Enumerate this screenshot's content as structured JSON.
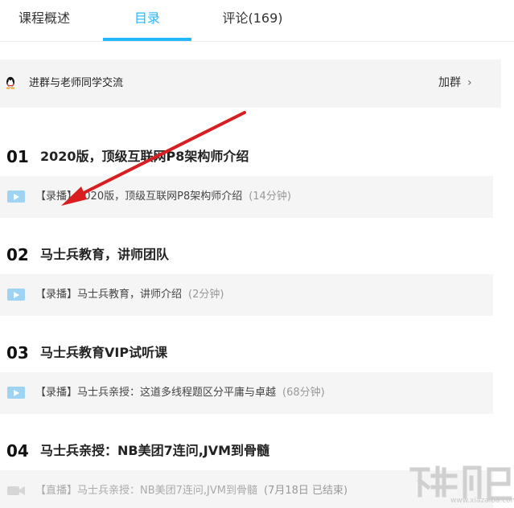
{
  "tabs": [
    {
      "label": "课程概述"
    },
    {
      "label": "目录"
    },
    {
      "label": "评论(169)"
    }
  ],
  "group": {
    "text": "进群与老师同学交流",
    "join_label": "加群"
  },
  "chapters": [
    {
      "num": "01",
      "title": "2020版，顶级互联网P8架构师介绍",
      "lesson": {
        "tag": "【录播】",
        "name": "2020版，顶级互联网P8架构师介绍",
        "duration": "(14分钟)"
      }
    },
    {
      "num": "02",
      "title": "马士兵教育，讲师团队",
      "lesson": {
        "tag": "【录播】",
        "name": "马士兵教育，讲师介绍",
        "duration": "(2分钟)"
      }
    },
    {
      "num": "03",
      "title": "马士兵教育VIP试听课",
      "lesson": {
        "tag": "【录播】",
        "name": "马士兵亲授：这道多线程题区分平庸与卓越",
        "duration": "(68分钟)"
      }
    },
    {
      "num": "04",
      "title": "马士兵亲授：NB美团7连问,JVM到骨髓",
      "lesson": {
        "tag": "【直播】",
        "name": "马士兵亲授：NB美团7连问,JVM到骨髓",
        "duration": "(7月18日 已结束)"
      }
    }
  ],
  "watermark": {
    "text": "www.xiazaiba.com"
  },
  "colors": {
    "accent": "#23b8ff",
    "arrow": "#d81e1e",
    "lesson_bg": "#f5f5f5"
  },
  "icons": [
    "qq-penguin-icon",
    "chevron-right-icon",
    "play-video-icon",
    "video-camera-icon"
  ]
}
